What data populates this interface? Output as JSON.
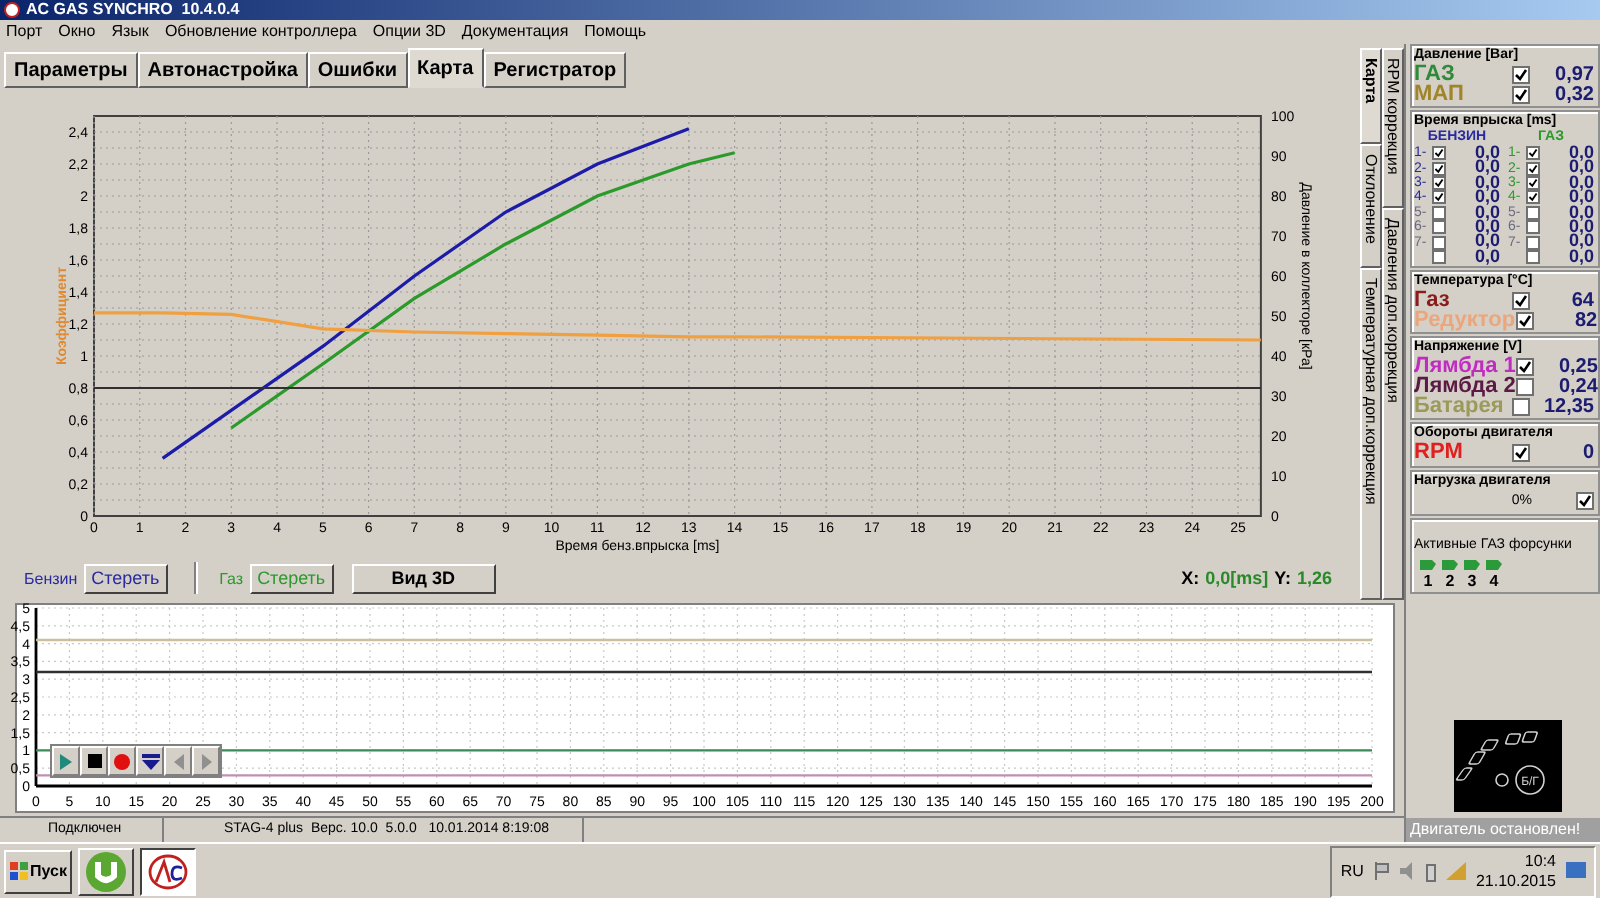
{
  "window": {
    "title": "AC GAS SYNCHRO  10.4.0.4"
  },
  "menu": [
    "Порт",
    "Окно",
    "Язык",
    "Обновление контроллера",
    "Опции 3D",
    "Документация",
    "Помощь"
  ],
  "tabs": [
    {
      "label": "Параметры",
      "selected": false
    },
    {
      "label": "Автонастройка",
      "selected": false
    },
    {
      "label": "Ошибки",
      "selected": false
    },
    {
      "label": "Карта",
      "selected": true
    },
    {
      "label": "Регистратор",
      "selected": false
    }
  ],
  "map_chart": {
    "right_label": "Давление в коллекторе [кРа]",
    "right_ticks": [
      "100",
      "90",
      "80",
      "70",
      "60",
      "50",
      "40",
      "30",
      "20",
      "10",
      "0"
    ],
    "chart_data": {
      "type": "line",
      "xlabel": "Время бенз.впрыска [ms]",
      "ylabel": "Коэффициент",
      "x": [
        0,
        1.5,
        3,
        5,
        7,
        9,
        11,
        13,
        14,
        25.5
      ],
      "series": [
        {
          "color": "#1c1ca8",
          "values": [
            null,
            0.36,
            0.66,
            1.06,
            1.5,
            1.9,
            2.2,
            2.42,
            null,
            null
          ]
        },
        {
          "color": "#2a9a2a",
          "values": [
            null,
            null,
            0.55,
            0.95,
            1.36,
            1.7,
            2.0,
            2.2,
            2.27,
            null
          ]
        },
        {
          "color": "#f0a040",
          "values": [
            1.27,
            1.27,
            1.26,
            1.17,
            1.15,
            1.14,
            1.13,
            1.12,
            1.12,
            1.1
          ]
        },
        {
          "color": "#303030",
          "values": [
            0.8,
            0.8,
            0.8,
            0.8,
            0.8,
            0.8,
            0.8,
            0.8,
            0.8,
            0.8
          ]
        }
      ],
      "xlim": [
        0,
        25.5
      ],
      "ylim": [
        0,
        2.5
      ],
      "grid": true,
      "xticks": [
        0,
        1,
        2,
        3,
        4,
        5,
        6,
        7,
        8,
        9,
        10,
        11,
        12,
        13,
        14,
        15,
        16,
        17,
        18,
        19,
        20,
        21,
        22,
        23,
        24,
        25
      ],
      "yticks": [
        {
          "value": 0,
          "label": "0"
        },
        {
          "value": 0.2,
          "label": "0,2"
        },
        {
          "value": 0.4,
          "label": "0,4"
        },
        {
          "value": 0.6,
          "label": "0,6"
        },
        {
          "value": 0.8,
          "label": "0,8"
        },
        {
          "value": 1,
          "label": "1"
        },
        {
          "value": 1.2,
          "label": "1,2"
        },
        {
          "value": 1.4,
          "label": "1,4"
        },
        {
          "value": 1.6,
          "label": "1,6"
        },
        {
          "value": 1.8,
          "label": "1,8"
        },
        {
          "value": 2,
          "label": "2"
        },
        {
          "value": 2.2,
          "label": "2,2"
        },
        {
          "value": 2.4,
          "label": "2,4"
        }
      ]
    }
  },
  "controls": {
    "petrol_label": "Бензин",
    "petrol_clear": "Стереть",
    "gas_label": "Газ",
    "gas_clear": "Стереть",
    "view_3d": "Вид 3D",
    "x_label": "X:",
    "x_value": "0,0[ms]",
    "y_label": "Y:",
    "y_value": "1,26"
  },
  "side_tabs": {
    "inner": [
      {
        "label": "Карта",
        "selected": true
      },
      {
        "label": "Отклонение",
        "selected": false
      },
      {
        "label": "Температурная доп.коррекция",
        "selected": false
      }
    ],
    "outer": [
      {
        "label": "RPM коррекция",
        "selected": false
      },
      {
        "label": "Давления доп.коррекция",
        "selected": false
      }
    ]
  },
  "recorder_chart": {
    "chart_data": {
      "type": "line",
      "x": [
        0,
        200
      ],
      "series": [
        {
          "color": "#cbbf9f",
          "values": [
            4.1,
            4.1
          ]
        },
        {
          "color": "#303030",
          "values": [
            3.2,
            3.2
          ]
        },
        {
          "color": "#3a8a5a",
          "values": [
            1,
            1
          ]
        },
        {
          "color": "#c090b0",
          "values": [
            0.3,
            0.3
          ]
        }
      ],
      "xlim": [
        0,
        200
      ],
      "ylim": [
        0,
        5
      ],
      "grid": true,
      "xticks": [
        0,
        5,
        10,
        15,
        20,
        25,
        30,
        35,
        40,
        45,
        50,
        55,
        60,
        65,
        70,
        75,
        80,
        85,
        90,
        95,
        100,
        105,
        110,
        115,
        120,
        125,
        130,
        135,
        140,
        145,
        150,
        155,
        160,
        165,
        170,
        175,
        180,
        185,
        190,
        195,
        200
      ],
      "yticks": [
        {
          "value": 0,
          "label": "0"
        },
        {
          "value": 0.5,
          "label": "0,5"
        },
        {
          "value": 1,
          "label": "1"
        },
        {
          "value": 1.5,
          "label": "1,5"
        },
        {
          "value": 2,
          "label": "2"
        },
        {
          "value": 2.5,
          "label": "2,5"
        },
        {
          "value": 3,
          "label": "3"
        },
        {
          "value": 3.5,
          "label": "3,5"
        },
        {
          "value": 4,
          "label": "4"
        },
        {
          "value": 4.5,
          "label": "4,5"
        },
        {
          "value": 5,
          "label": "5"
        }
      ]
    },
    "playback": [
      {
        "kind": "play",
        "disabled": false
      },
      {
        "kind": "stop",
        "disabled": false
      },
      {
        "kind": "record",
        "disabled": false
      },
      {
        "kind": "menu",
        "disabled": false
      },
      {
        "kind": "back",
        "disabled": true
      },
      {
        "kind": "forward",
        "disabled": true
      }
    ]
  },
  "status_bar": [
    "Подключен",
    "STAG-4 plus  Верс. 10.0  5.0.0   10.01.2014 8:19:08"
  ],
  "gauges": {
    "pressure": {
      "title": "Давление [Bar]",
      "rows": [
        {
          "label": "ГАЗ",
          "color": "#2f8a3a",
          "checked": true,
          "value": "0,97"
        },
        {
          "label": "МАП",
          "color": "#a08428",
          "checked": true,
          "value": "0,32"
        }
      ]
    },
    "injection": {
      "title": "Время впрыска [ms]",
      "columns": [
        {
          "title": "БЕНЗИН",
          "color": "#2a2aa0",
          "cells": [
            {
              "index": "1-",
              "disabled": false,
              "checked": true,
              "value": "0,0"
            },
            {
              "index": "2-",
              "disabled": false,
              "checked": true,
              "value": "0,0"
            },
            {
              "index": "3-",
              "disabled": false,
              "checked": true,
              "value": "0,0"
            },
            {
              "index": "4-",
              "disabled": false,
              "checked": true,
              "value": "0,0"
            },
            {
              "index": "5-",
              "disabled": true,
              "checked": false,
              "value": "0,0"
            },
            {
              "index": "6-",
              "disabled": true,
              "checked": false,
              "value": "0,0"
            },
            {
              "index": "7-",
              "disabled": true,
              "checked": false,
              "value": "0,0"
            },
            {
              "checked": false,
              "value": "0,0"
            }
          ]
        },
        {
          "title": "ГАЗ",
          "color": "#2a9a2a",
          "cells": [
            {
              "index": "1-",
              "disabled": false,
              "checked": true,
              "value": "0,0"
            },
            {
              "index": "2-",
              "disabled": false,
              "checked": true,
              "value": "0,0"
            },
            {
              "index": "3-",
              "disabled": false,
              "checked": true,
              "value": "0,0"
            },
            {
              "index": "4-",
              "disabled": false,
              "checked": true,
              "value": "0,0"
            },
            {
              "index": "5-",
              "disabled": true,
              "checked": false,
              "value": "0,0"
            },
            {
              "index": "6-",
              "disabled": true,
              "checked": false,
              "value": "0,0"
            },
            {
              "index": "7-",
              "disabled": true,
              "checked": false,
              "value": "0,0"
            },
            {
              "checked": false,
              "value": "0,0"
            }
          ]
        }
      ]
    },
    "temperature": {
      "title": "Температура [°C]",
      "rows": [
        {
          "label": "Газ",
          "color": "#8a1c1c",
          "checked": true,
          "value": "64"
        },
        {
          "label": "Редуктор",
          "color": "#eba67c",
          "checked": true,
          "value": "82"
        }
      ]
    },
    "voltage": {
      "title": "Напряжение [V]",
      "rows": [
        {
          "label": "Лямбда 1",
          "color": "#c02cc0",
          "checked": true,
          "value": "0,25"
        },
        {
          "label": "Лямбда 2",
          "color": "#5a1a44",
          "checked": false,
          "value": "0,24"
        },
        {
          "label": "Батарея",
          "color": "#9a9a5a",
          "checked": false,
          "value": "12,35"
        }
      ]
    },
    "rpm": {
      "title": "Обороты двигателя",
      "rows": [
        {
          "label": "RPM",
          "color": "#e02020",
          "checked": true,
          "value": "0"
        }
      ]
    },
    "load": {
      "title": "Нагрузка двигателя",
      "value": "0%",
      "checked": true
    },
    "injectors": {
      "title": "Активные ГАЗ форсунки",
      "items": [
        {
          "label": "1",
          "on": true
        },
        {
          "label": "2",
          "on": true
        },
        {
          "label": "3",
          "on": true
        },
        {
          "label": "4",
          "on": true
        }
      ]
    },
    "engine": {
      "fuel_badge": "Б/Г",
      "status": "Двигатель остановлен!"
    }
  },
  "taskbar": {
    "start": "Пуск",
    "apps": [
      {
        "kind": "torrent",
        "selected": false
      },
      {
        "kind": "synchro",
        "selected": true
      }
    ],
    "tray": {
      "language": "RU",
      "time": "10:4",
      "date": "21.10.2015"
    }
  }
}
